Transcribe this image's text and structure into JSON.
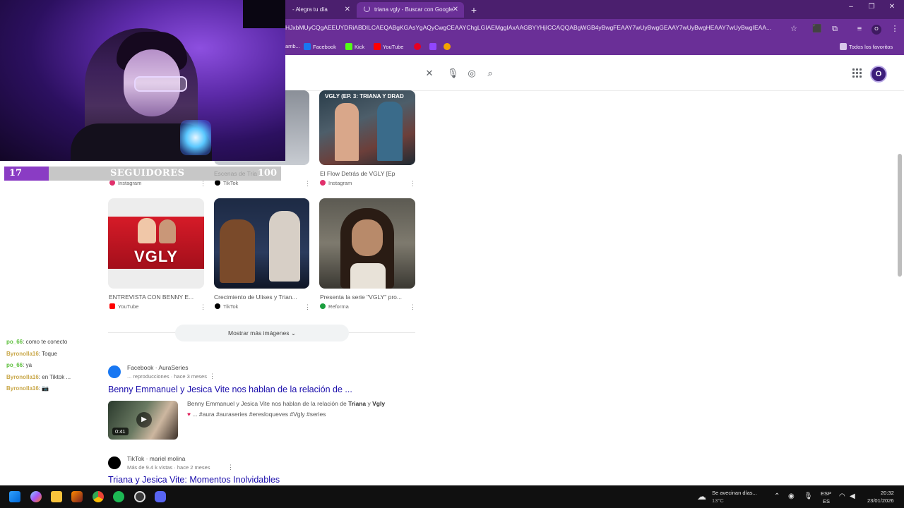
{
  "browser": {
    "tabs": [
      {
        "label": "- Alegra tu día",
        "active": false
      },
      {
        "label": "triana vgly - Buscar con Google",
        "active": true
      }
    ],
    "url": "HJxbMUyCQgAEEUYDRiABDILCAEQABgKGAsYgAQyCwgCEAAYChgLGIAEMggIAxAAGBYYHjICCAQQABgWGB4yBwgFEAAY7wUyBwgGEAAY7wUyBwgHEAAY7wUyBwgIEAA...",
    "bookmarks": [
      {
        "label": "amb...",
        "color": "#6a2f97"
      },
      {
        "label": "Facebook",
        "color": "#1877f2"
      },
      {
        "label": "Kick",
        "color": "#53fc18"
      },
      {
        "label": "YouTube",
        "color": "#ff0000"
      },
      {
        "label": "",
        "color": "#e60023"
      },
      {
        "label": "",
        "color": "#9146ff"
      },
      {
        "label": "",
        "color": "#f4a300"
      }
    ],
    "all_bookmarks": "Todos los favoritos",
    "accent": "#6a2f97"
  },
  "google": {
    "avatar_letter": "O",
    "image_row1": [
      {
        "caption": "",
        "source": "Instagram",
        "source_color": "#e1306c"
      },
      {
        "caption": "Escenas de Tria",
        "source": "TikTok",
        "source_color": "#000000"
      },
      {
        "caption": "El Flow Detrás de VGLY [Ep",
        "source": "Instagram",
        "source_color": "#e1306c"
      }
    ],
    "image_row2": [
      {
        "caption": "ENTREVISTA CON BENNY E...",
        "source": "YouTube",
        "source_color": "#ff0000"
      },
      {
        "caption": "Crecimiento de Ulises y Trian...",
        "source": "TikTok",
        "source_color": "#000000"
      },
      {
        "caption": "Presenta la serie \"VGLY\" pro...",
        "source": "Reforma",
        "source_color": "#1a9e3e"
      }
    ],
    "thumb_text": {
      "vgly_ep": "VGLY (EP. 3: TRIANA Y DRAD",
      "vgly_logo": "VGLY"
    },
    "more_images": "Mostrar más imágenes",
    "result1": {
      "site": "Facebook · AuraSeries",
      "meta": "... reproducciones · hace 3 meses",
      "title": "Benny Emmanuel y Jesica Vite nos hablan de la relación de ...",
      "snippet_pre": "Benny Emmanuel y Jesica Vite nos hablan de la relación de ",
      "snippet_b1": "Triana",
      "snippet_mid": " y ",
      "snippet_b2": "Vgly",
      "snippet_line2": "... #aura #auraseries #eresloqueves #Vgly #series",
      "duration": "0:41"
    },
    "result2": {
      "site": "TikTok · mariel molina",
      "meta": "Más de 9.4 k vistas · hace 2 meses",
      "title": "Triana y Jesica Vite: Momentos Inolvidables"
    }
  },
  "overlay": {
    "follower_count": "17",
    "follower_label": "SEGUIDORES",
    "follower_goal": "100",
    "progress_fraction": 0.17,
    "chat": [
      {
        "user": "po_66",
        "user_color": "#5ec03e",
        "text": ": como te conecto"
      },
      {
        "user": "Byronolla16",
        "user_color": "#c9a84a",
        "text": ": Toque"
      },
      {
        "user": "po_66",
        "user_color": "#5ec03e",
        "text": ": ya"
      },
      {
        "user": "Byronolla16",
        "user_color": "#c9a84a",
        "text": ": en Tiktok ..."
      },
      {
        "user": "Byronolla16",
        "user_color": "#c9a84a",
        "text": ": 📷"
      }
    ]
  },
  "taskbar": {
    "weather_title": "Se avecinan días...",
    "weather_temp": "13°C",
    "lang_top": "ESP",
    "lang_bottom": "ES",
    "time": "20:32",
    "date": "23/01/2026"
  }
}
